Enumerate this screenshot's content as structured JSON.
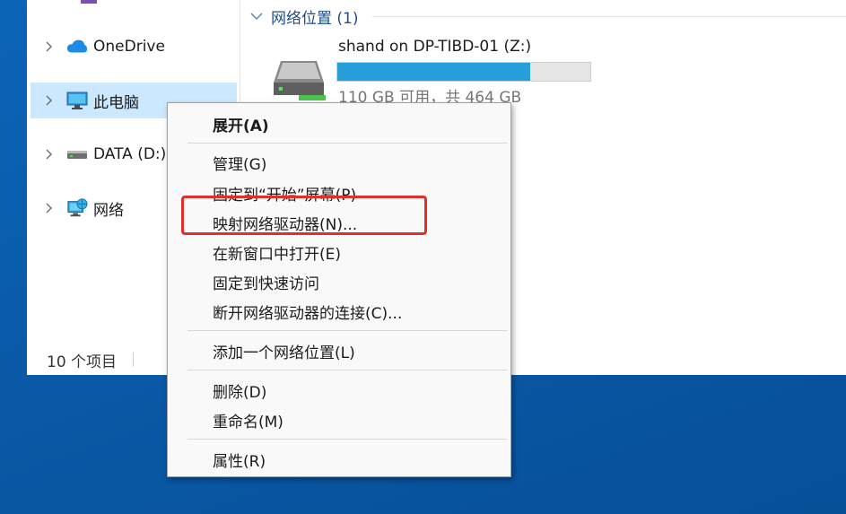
{
  "navigation": {
    "items": [
      {
        "label": "OneDrive",
        "icon": "onedrive-cloud-icon"
      },
      {
        "label": "此电脑",
        "icon": "this-pc-monitor-icon"
      },
      {
        "label": "DATA (D:)",
        "icon": "drive-icon"
      },
      {
        "label": "网络",
        "icon": "network-icon"
      }
    ]
  },
  "status_bar": {
    "item_count": "10 个项目"
  },
  "content": {
    "group": {
      "title": "网络位置 (1)"
    },
    "drive": {
      "name": "shand on DP-TIBD-01 (Z:)",
      "free_text": "110 GB 可用，共 464 GB",
      "used_fraction": 0.763
    }
  },
  "context_menu": {
    "items": [
      {
        "label": "展开(A)"
      },
      {
        "label": "管理(G)"
      },
      {
        "label": "固定到“开始”屏幕(P)"
      },
      {
        "label": "映射网络驱动器(N)..."
      },
      {
        "label": "在新窗口中打开(E)"
      },
      {
        "label": "固定到快速访问"
      },
      {
        "label": "断开网络驱动器的连接(C)..."
      },
      {
        "label": "添加一个网络位置(L)"
      },
      {
        "label": "删除(D)"
      },
      {
        "label": "重命名(M)"
      },
      {
        "label": "属性(R)"
      }
    ]
  },
  "colors": {
    "accent": "#26a0da",
    "selection": "#cce8ff",
    "highlight_box": "#e0302a",
    "desktop": "#0a5aa8"
  }
}
